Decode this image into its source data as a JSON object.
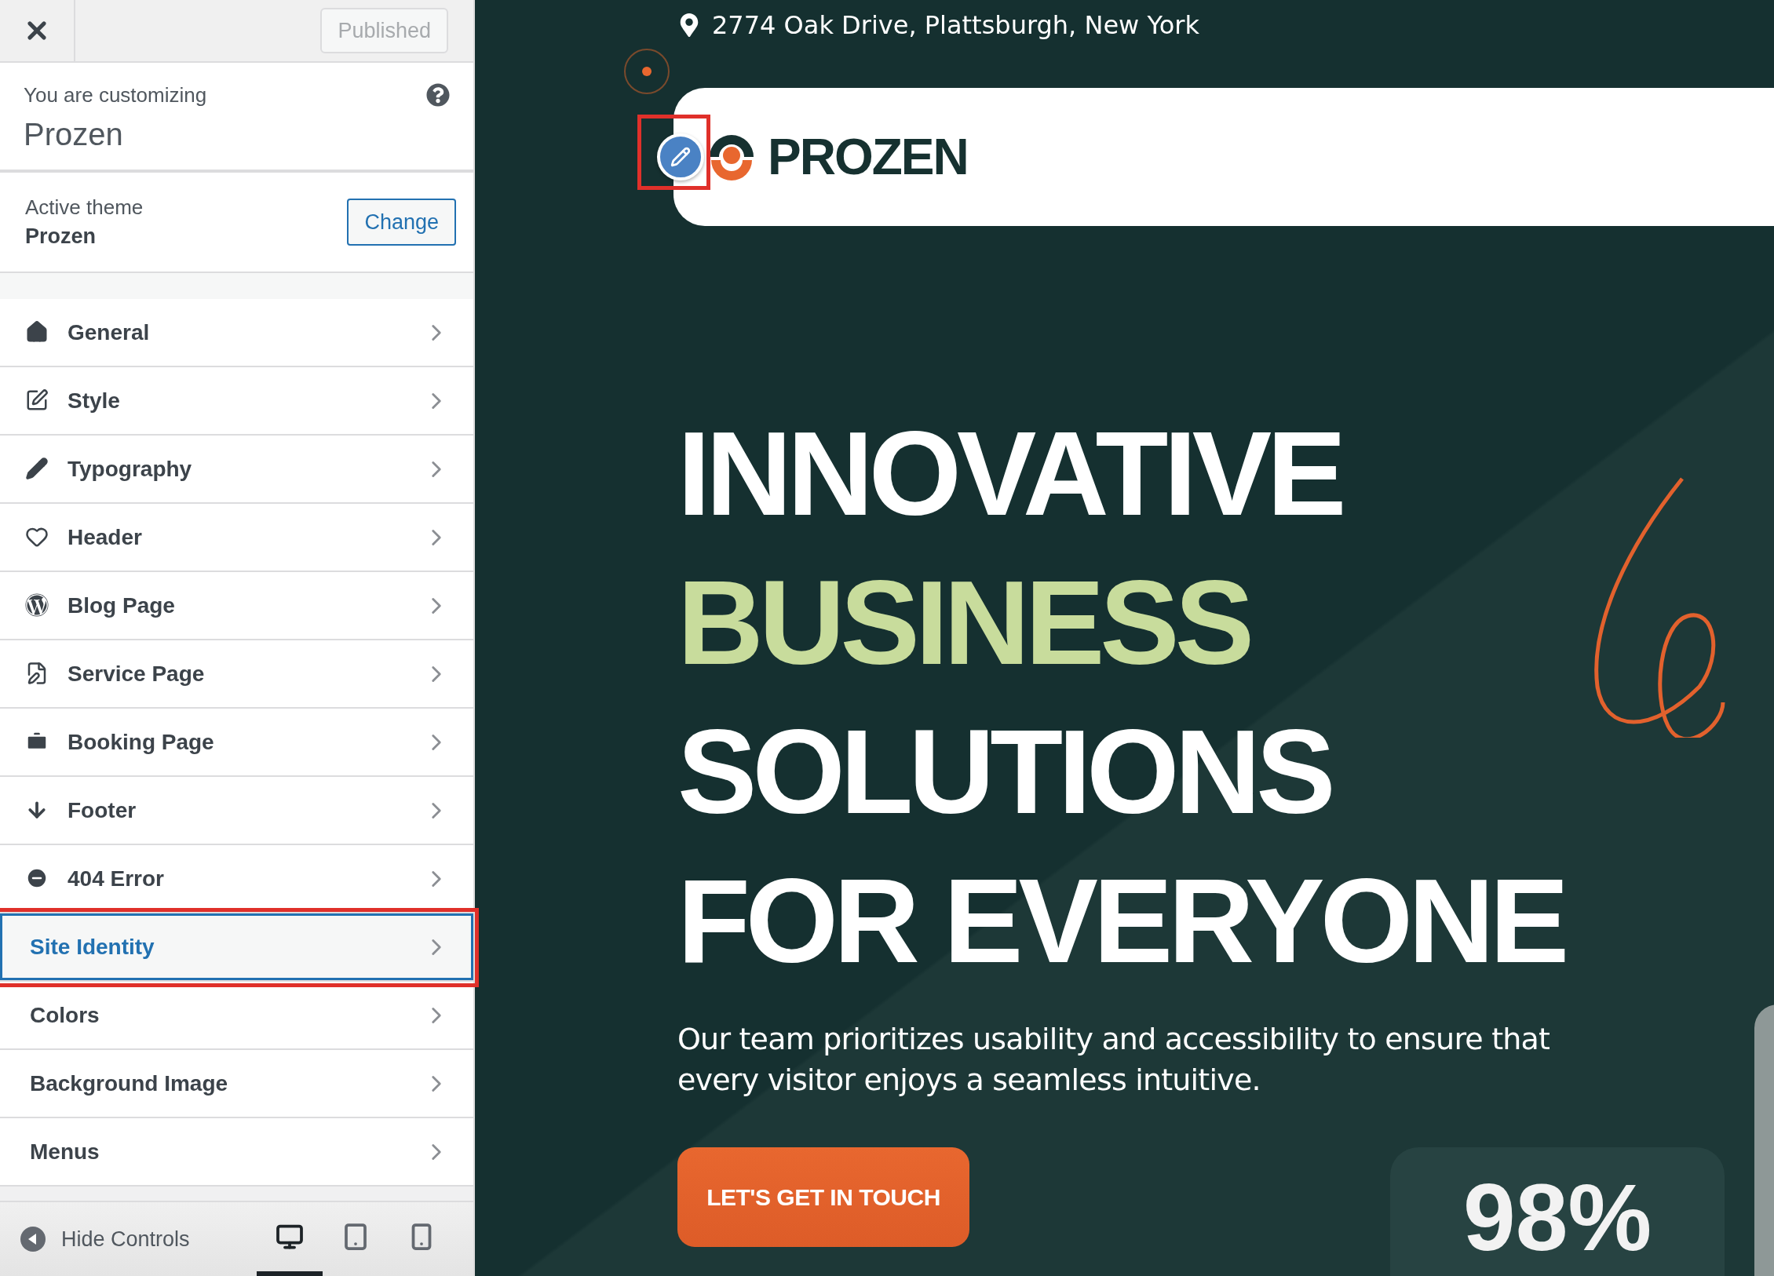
{
  "topbar": {
    "publish_button": "Published"
  },
  "customizing": {
    "label": "You are customizing",
    "site": "Prozen"
  },
  "theme": {
    "label": "Active theme",
    "name": "Prozen",
    "button": "Change"
  },
  "sections": [
    {
      "label": "General",
      "kind": "panel",
      "selected": false
    },
    {
      "label": "Style",
      "kind": "panel",
      "selected": false
    },
    {
      "label": "Typography",
      "kind": "panel",
      "selected": false
    },
    {
      "label": "Header",
      "kind": "panel",
      "selected": false
    },
    {
      "label": "Blog Page",
      "kind": "panel",
      "selected": false
    },
    {
      "label": "Service Page",
      "kind": "panel",
      "selected": false
    },
    {
      "label": "Booking Page",
      "kind": "panel",
      "selected": false
    },
    {
      "label": "Footer",
      "kind": "panel",
      "selected": false
    },
    {
      "label": "404 Error",
      "kind": "panel",
      "selected": false
    },
    {
      "label": "Site Identity",
      "kind": "section",
      "selected": true
    },
    {
      "label": "Colors",
      "kind": "section",
      "selected": false
    },
    {
      "label": "Background Image",
      "kind": "section",
      "selected": false
    },
    {
      "label": "Menus",
      "kind": "section",
      "selected": false
    }
  ],
  "footer": {
    "hide_controls": "Hide Controls",
    "devices": [
      {
        "selected": true
      },
      {
        "selected": false
      },
      {
        "selected": false
      }
    ]
  },
  "preview": {
    "address": "2774 Oak Drive, Plattsburgh, New York",
    "logo": "PROZEN",
    "headline": [
      {
        "text": "INNOVATIVE",
        "accent": false
      },
      {
        "text": "BUSINESS",
        "accent": true
      },
      {
        "text": "SOLUTIONS",
        "accent": false
      },
      {
        "text": "FOR EVERYONE",
        "accent": false
      }
    ],
    "description": "Our team prioritizes usability and accessibility to ensure that every visitor enjoys a seamless intuitive.",
    "cta": "LET'S GET IN TOUCH",
    "stat": "98%"
  }
}
